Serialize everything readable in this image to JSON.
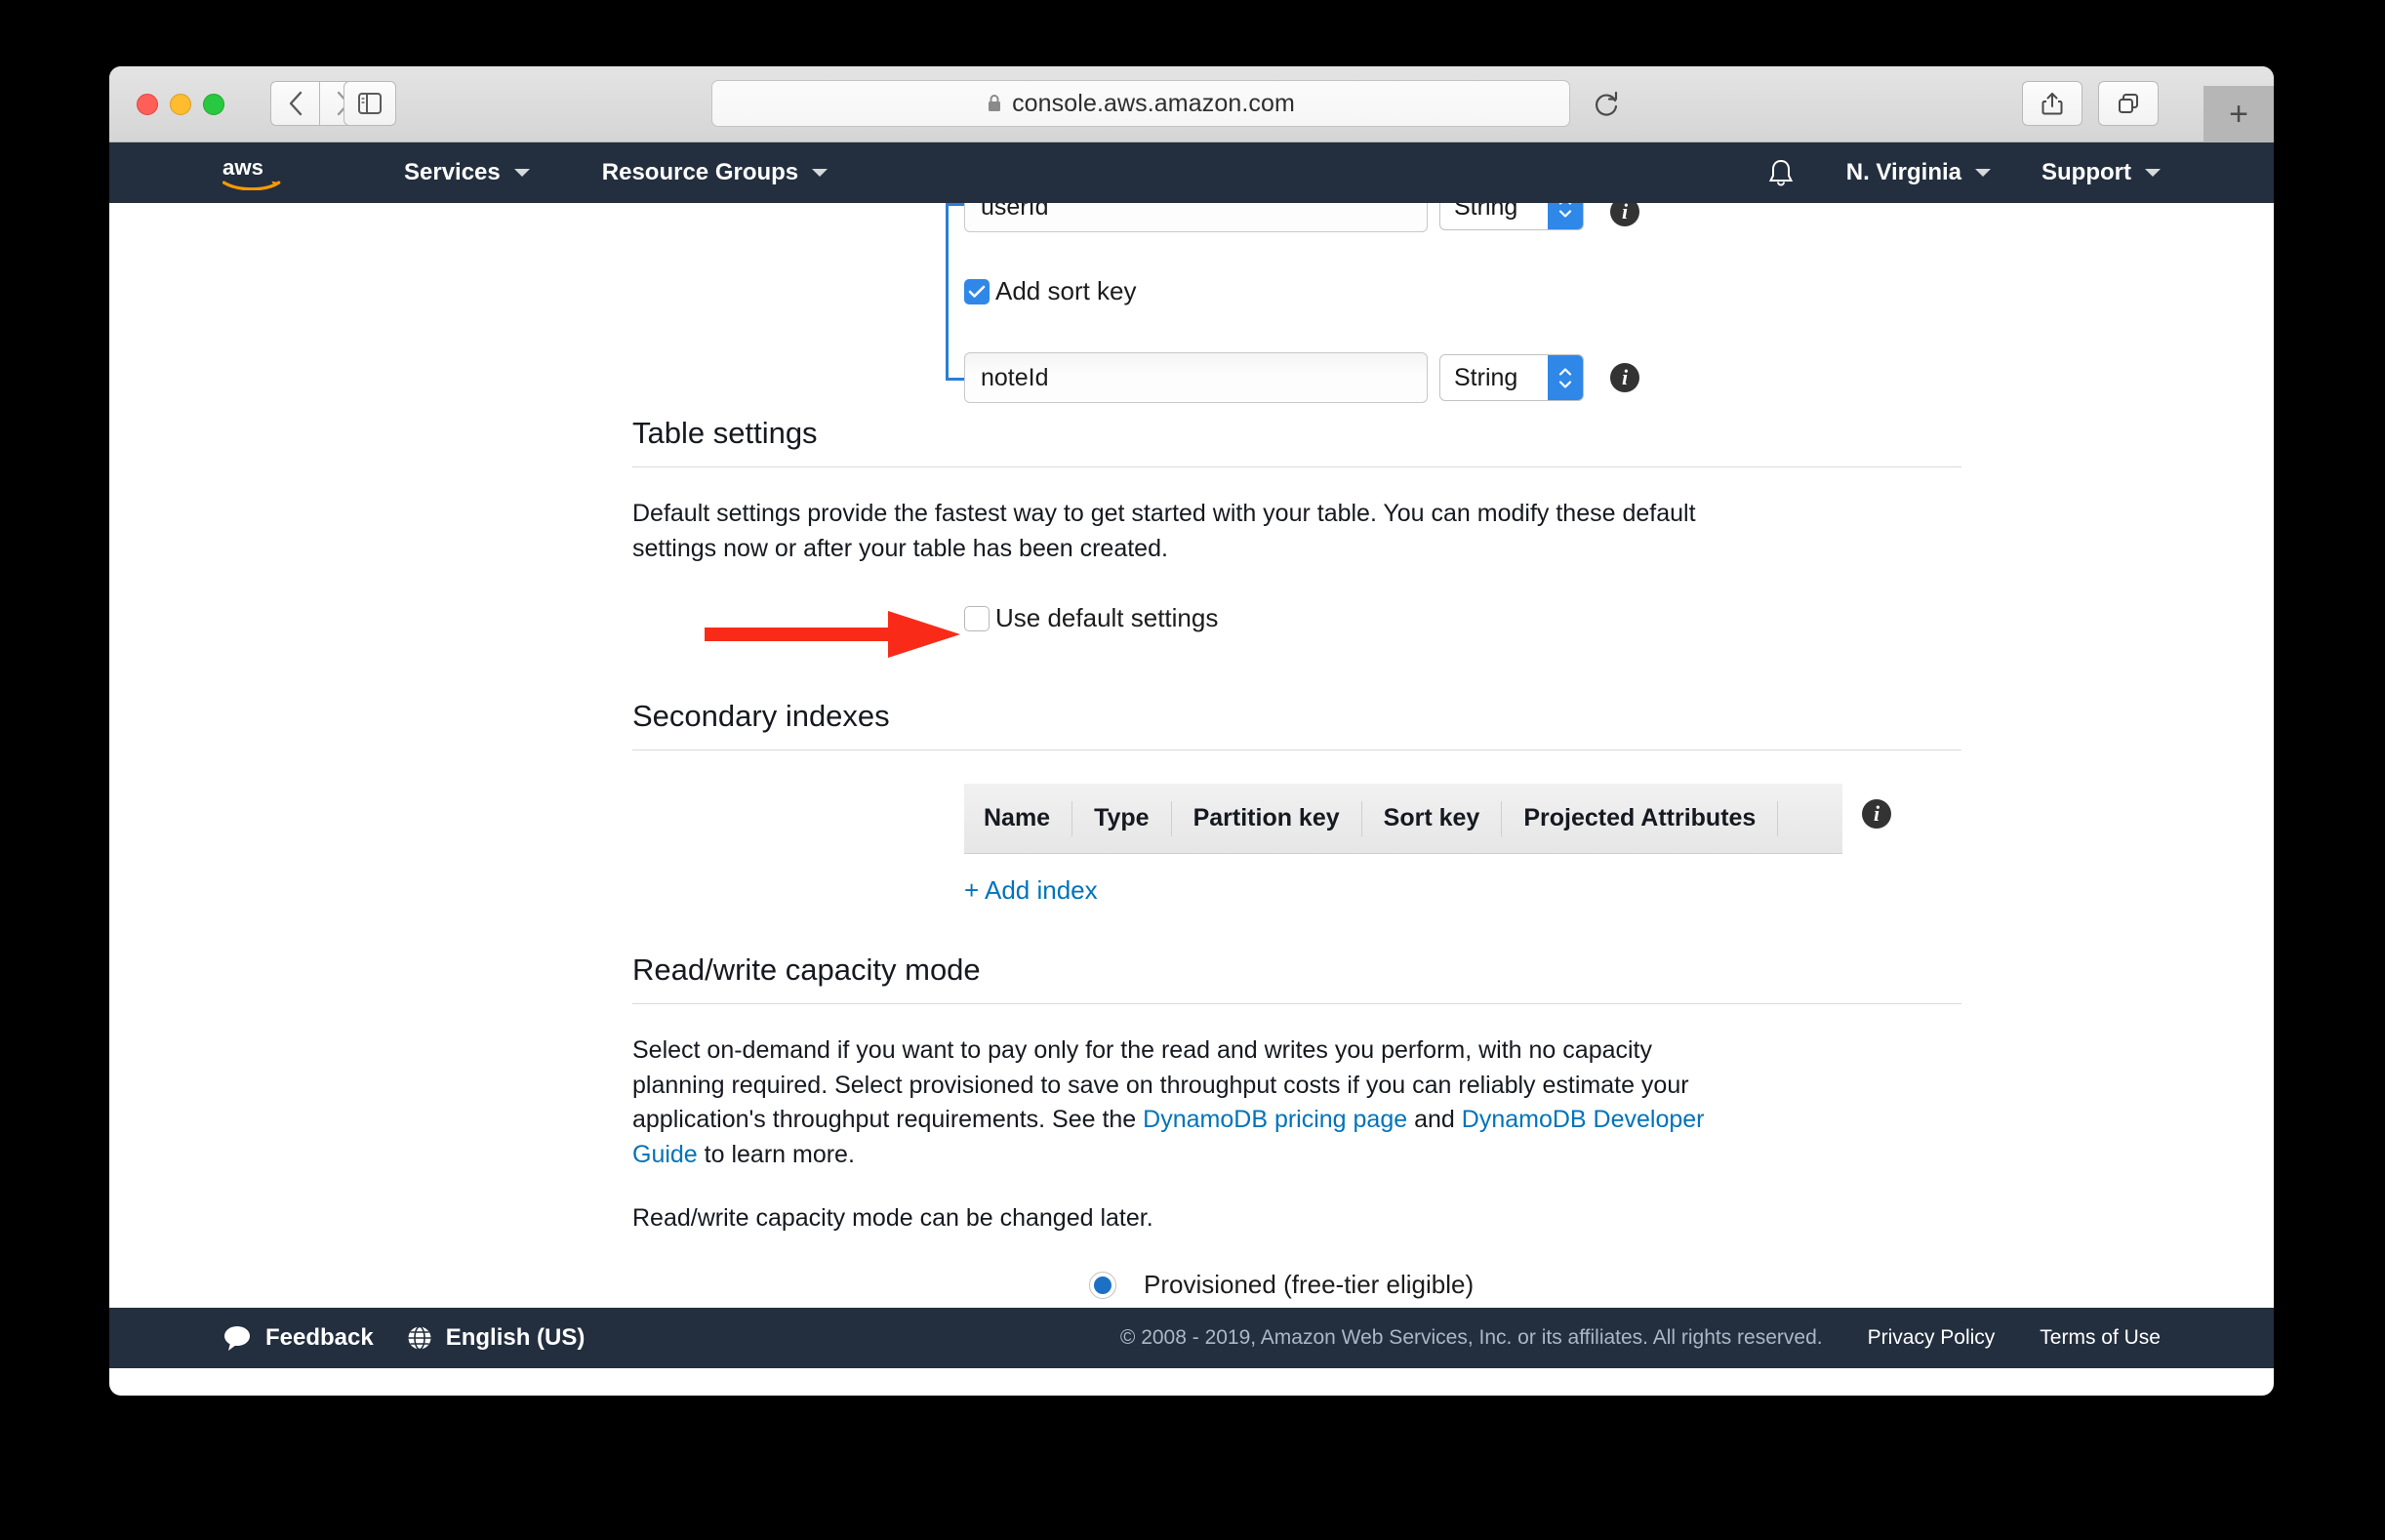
{
  "browser": {
    "url": "console.aws.amazon.com",
    "lock_icon": "lock-icon",
    "back_icon": "chevron-left-icon",
    "forward_icon": "chevron-right-icon",
    "sidebar_icon": "sidebar-toggle-icon",
    "reload_icon": "reload-icon",
    "share_icon": "share-icon",
    "tabs_icon": "show-all-tabs-icon",
    "new_tab_label": "+"
  },
  "aws_nav": {
    "logo": "aws-logo",
    "services_label": "Services",
    "resource_groups_label": "Resource Groups",
    "bell_icon": "notifications-bell-icon",
    "region_label": "N. Virginia",
    "support_label": "Support"
  },
  "form": {
    "partition_key_value": "userId",
    "partition_key_type": "String",
    "add_sort_key_label": "Add sort key",
    "add_sort_key_checked": true,
    "sort_key_value": "noteId",
    "sort_key_type": "String",
    "info_icon": "info-icon"
  },
  "table_settings": {
    "title": "Table settings",
    "description": "Default settings provide the fastest way to get started with your table. You can modify these default settings now or after your table has been created.",
    "use_default_label": "Use default settings",
    "use_default_checked": false,
    "annotation_icon": "red-arrow-annotation",
    "annotation_color": "#f92b18"
  },
  "secondary_indexes": {
    "title": "Secondary indexes",
    "columns": [
      "Name",
      "Type",
      "Partition key",
      "Sort key",
      "Projected Attributes"
    ],
    "rows": [],
    "add_index_label": "+ Add index",
    "info_icon": "info-icon"
  },
  "read_write": {
    "title": "Read/write capacity mode",
    "para1_before": "Select on-demand if you want to pay only for the read and writes you perform, with no capacity planning required. Select provisioned to save on throughput costs if you can reliably estimate your application's throughput requirements. See the ",
    "link1": "DynamoDB pricing page",
    "para1_mid": " and ",
    "link2": "DynamoDB Developer Guide",
    "para1_after": " to learn more.",
    "para2": "Read/write capacity mode can be changed later.",
    "provisioned_label": "Provisioned (free-tier eligible)",
    "provisioned_selected": true
  },
  "footer": {
    "feedback_label": "Feedback",
    "feedback_icon": "speech-bubble-icon",
    "language_label": "English (US)",
    "language_icon": "globe-icon",
    "copyright": "© 2008 - 2019, Amazon Web Services, Inc. or its affiliates. All rights reserved.",
    "privacy_label": "Privacy Policy",
    "terms_label": "Terms of Use"
  },
  "colors": {
    "aws_dark": "#232f3e",
    "link_blue": "#0073bb",
    "accent_blue": "#2f87e8",
    "annotation_red": "#f92b18"
  }
}
